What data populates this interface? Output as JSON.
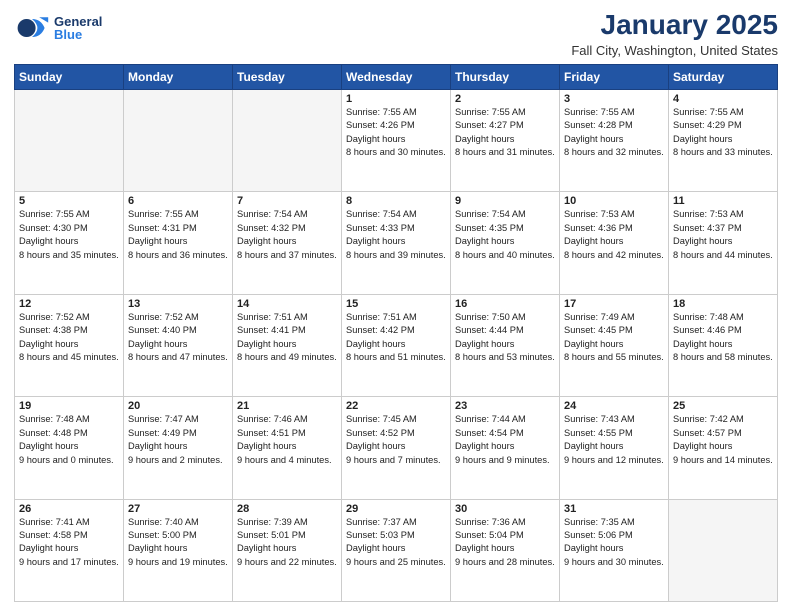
{
  "header": {
    "logo": {
      "general": "General",
      "blue": "Blue"
    },
    "title": "January 2025",
    "location": "Fall City, Washington, United States"
  },
  "weekdays": [
    "Sunday",
    "Monday",
    "Tuesday",
    "Wednesday",
    "Thursday",
    "Friday",
    "Saturday"
  ],
  "weeks": [
    [
      {
        "day": "",
        "empty": true
      },
      {
        "day": "",
        "empty": true
      },
      {
        "day": "",
        "empty": true
      },
      {
        "day": "1",
        "sunrise": "7:55 AM",
        "sunset": "4:26 PM",
        "daylight": "8 hours and 30 minutes."
      },
      {
        "day": "2",
        "sunrise": "7:55 AM",
        "sunset": "4:27 PM",
        "daylight": "8 hours and 31 minutes."
      },
      {
        "day": "3",
        "sunrise": "7:55 AM",
        "sunset": "4:28 PM",
        "daylight": "8 hours and 32 minutes."
      },
      {
        "day": "4",
        "sunrise": "7:55 AM",
        "sunset": "4:29 PM",
        "daylight": "8 hours and 33 minutes."
      }
    ],
    [
      {
        "day": "5",
        "sunrise": "7:55 AM",
        "sunset": "4:30 PM",
        "daylight": "8 hours and 35 minutes."
      },
      {
        "day": "6",
        "sunrise": "7:55 AM",
        "sunset": "4:31 PM",
        "daylight": "8 hours and 36 minutes."
      },
      {
        "day": "7",
        "sunrise": "7:54 AM",
        "sunset": "4:32 PM",
        "daylight": "8 hours and 37 minutes."
      },
      {
        "day": "8",
        "sunrise": "7:54 AM",
        "sunset": "4:33 PM",
        "daylight": "8 hours and 39 minutes."
      },
      {
        "day": "9",
        "sunrise": "7:54 AM",
        "sunset": "4:35 PM",
        "daylight": "8 hours and 40 minutes."
      },
      {
        "day": "10",
        "sunrise": "7:53 AM",
        "sunset": "4:36 PM",
        "daylight": "8 hours and 42 minutes."
      },
      {
        "day": "11",
        "sunrise": "7:53 AM",
        "sunset": "4:37 PM",
        "daylight": "8 hours and 44 minutes."
      }
    ],
    [
      {
        "day": "12",
        "sunrise": "7:52 AM",
        "sunset": "4:38 PM",
        "daylight": "8 hours and 45 minutes."
      },
      {
        "day": "13",
        "sunrise": "7:52 AM",
        "sunset": "4:40 PM",
        "daylight": "8 hours and 47 minutes."
      },
      {
        "day": "14",
        "sunrise": "7:51 AM",
        "sunset": "4:41 PM",
        "daylight": "8 hours and 49 minutes."
      },
      {
        "day": "15",
        "sunrise": "7:51 AM",
        "sunset": "4:42 PM",
        "daylight": "8 hours and 51 minutes."
      },
      {
        "day": "16",
        "sunrise": "7:50 AM",
        "sunset": "4:44 PM",
        "daylight": "8 hours and 53 minutes."
      },
      {
        "day": "17",
        "sunrise": "7:49 AM",
        "sunset": "4:45 PM",
        "daylight": "8 hours and 55 minutes."
      },
      {
        "day": "18",
        "sunrise": "7:48 AM",
        "sunset": "4:46 PM",
        "daylight": "8 hours and 58 minutes."
      }
    ],
    [
      {
        "day": "19",
        "sunrise": "7:48 AM",
        "sunset": "4:48 PM",
        "daylight": "9 hours and 0 minutes."
      },
      {
        "day": "20",
        "sunrise": "7:47 AM",
        "sunset": "4:49 PM",
        "daylight": "9 hours and 2 minutes."
      },
      {
        "day": "21",
        "sunrise": "7:46 AM",
        "sunset": "4:51 PM",
        "daylight": "9 hours and 4 minutes."
      },
      {
        "day": "22",
        "sunrise": "7:45 AM",
        "sunset": "4:52 PM",
        "daylight": "9 hours and 7 minutes."
      },
      {
        "day": "23",
        "sunrise": "7:44 AM",
        "sunset": "4:54 PM",
        "daylight": "9 hours and 9 minutes."
      },
      {
        "day": "24",
        "sunrise": "7:43 AM",
        "sunset": "4:55 PM",
        "daylight": "9 hours and 12 minutes."
      },
      {
        "day": "25",
        "sunrise": "7:42 AM",
        "sunset": "4:57 PM",
        "daylight": "9 hours and 14 minutes."
      }
    ],
    [
      {
        "day": "26",
        "sunrise": "7:41 AM",
        "sunset": "4:58 PM",
        "daylight": "9 hours and 17 minutes."
      },
      {
        "day": "27",
        "sunrise": "7:40 AM",
        "sunset": "5:00 PM",
        "daylight": "9 hours and 19 minutes."
      },
      {
        "day": "28",
        "sunrise": "7:39 AM",
        "sunset": "5:01 PM",
        "daylight": "9 hours and 22 minutes."
      },
      {
        "day": "29",
        "sunrise": "7:37 AM",
        "sunset": "5:03 PM",
        "daylight": "9 hours and 25 minutes."
      },
      {
        "day": "30",
        "sunrise": "7:36 AM",
        "sunset": "5:04 PM",
        "daylight": "9 hours and 28 minutes."
      },
      {
        "day": "31",
        "sunrise": "7:35 AM",
        "sunset": "5:06 PM",
        "daylight": "9 hours and 30 minutes."
      },
      {
        "day": "",
        "empty": true
      }
    ]
  ]
}
